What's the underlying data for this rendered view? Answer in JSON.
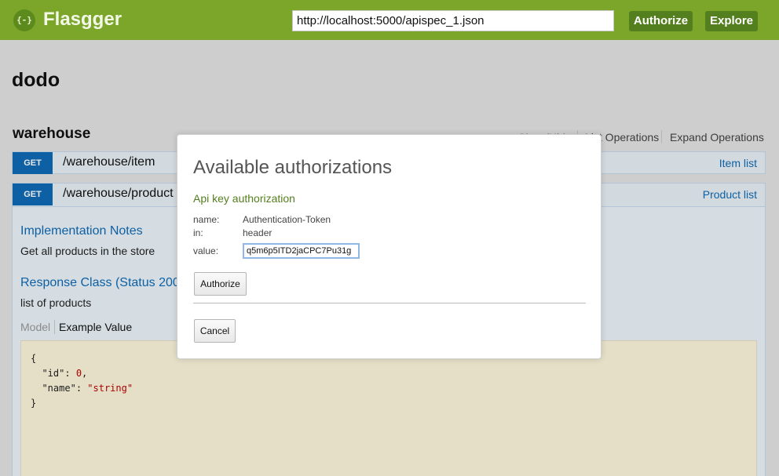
{
  "header": {
    "logo_icon": "{-}",
    "logo_text": "Flasgger",
    "spec_url": "http://localhost:5000/apispec_1.json",
    "authorize_label": "Authorize",
    "explore_label": "Explore"
  },
  "api": {
    "title": "dodo"
  },
  "resource": {
    "name": "warehouse",
    "show_hide": "Show/Hide",
    "list_operations": "List Operations",
    "expand_operations": "Expand Operations"
  },
  "operations": [
    {
      "method": "GET",
      "path": "/warehouse/item",
      "summary": "Item list"
    },
    {
      "method": "GET",
      "path": "/warehouse/product",
      "summary": "Product list"
    }
  ],
  "operation_detail": {
    "implementation_title": "Implementation Notes",
    "implementation_text": "Get all products in the store",
    "response_title": "Response Class (Status 200)",
    "response_text": "list of products",
    "tab_model": "Model",
    "tab_example": "Example Value",
    "code": {
      "open": "{",
      "id_key": "\"id\"",
      "id_val": "0",
      "name_key": "\"name\"",
      "name_val": "\"string\"",
      "close": "}"
    }
  },
  "modal": {
    "title": "Available authorizations",
    "subtitle": "Api key authorization",
    "name_label": "name:",
    "name_value": "Authentication-Token",
    "in_label": "in:",
    "in_value": "header",
    "value_label": "value:",
    "value_input": "q5m6p5ITD2jaCPC7Pu31g",
    "authorize_label": "Authorize",
    "cancel_label": "Cancel"
  },
  "colors": {
    "header_bg": "#7ba62a",
    "header_button": "#547f1e",
    "get_method": "#0f6ab4"
  }
}
